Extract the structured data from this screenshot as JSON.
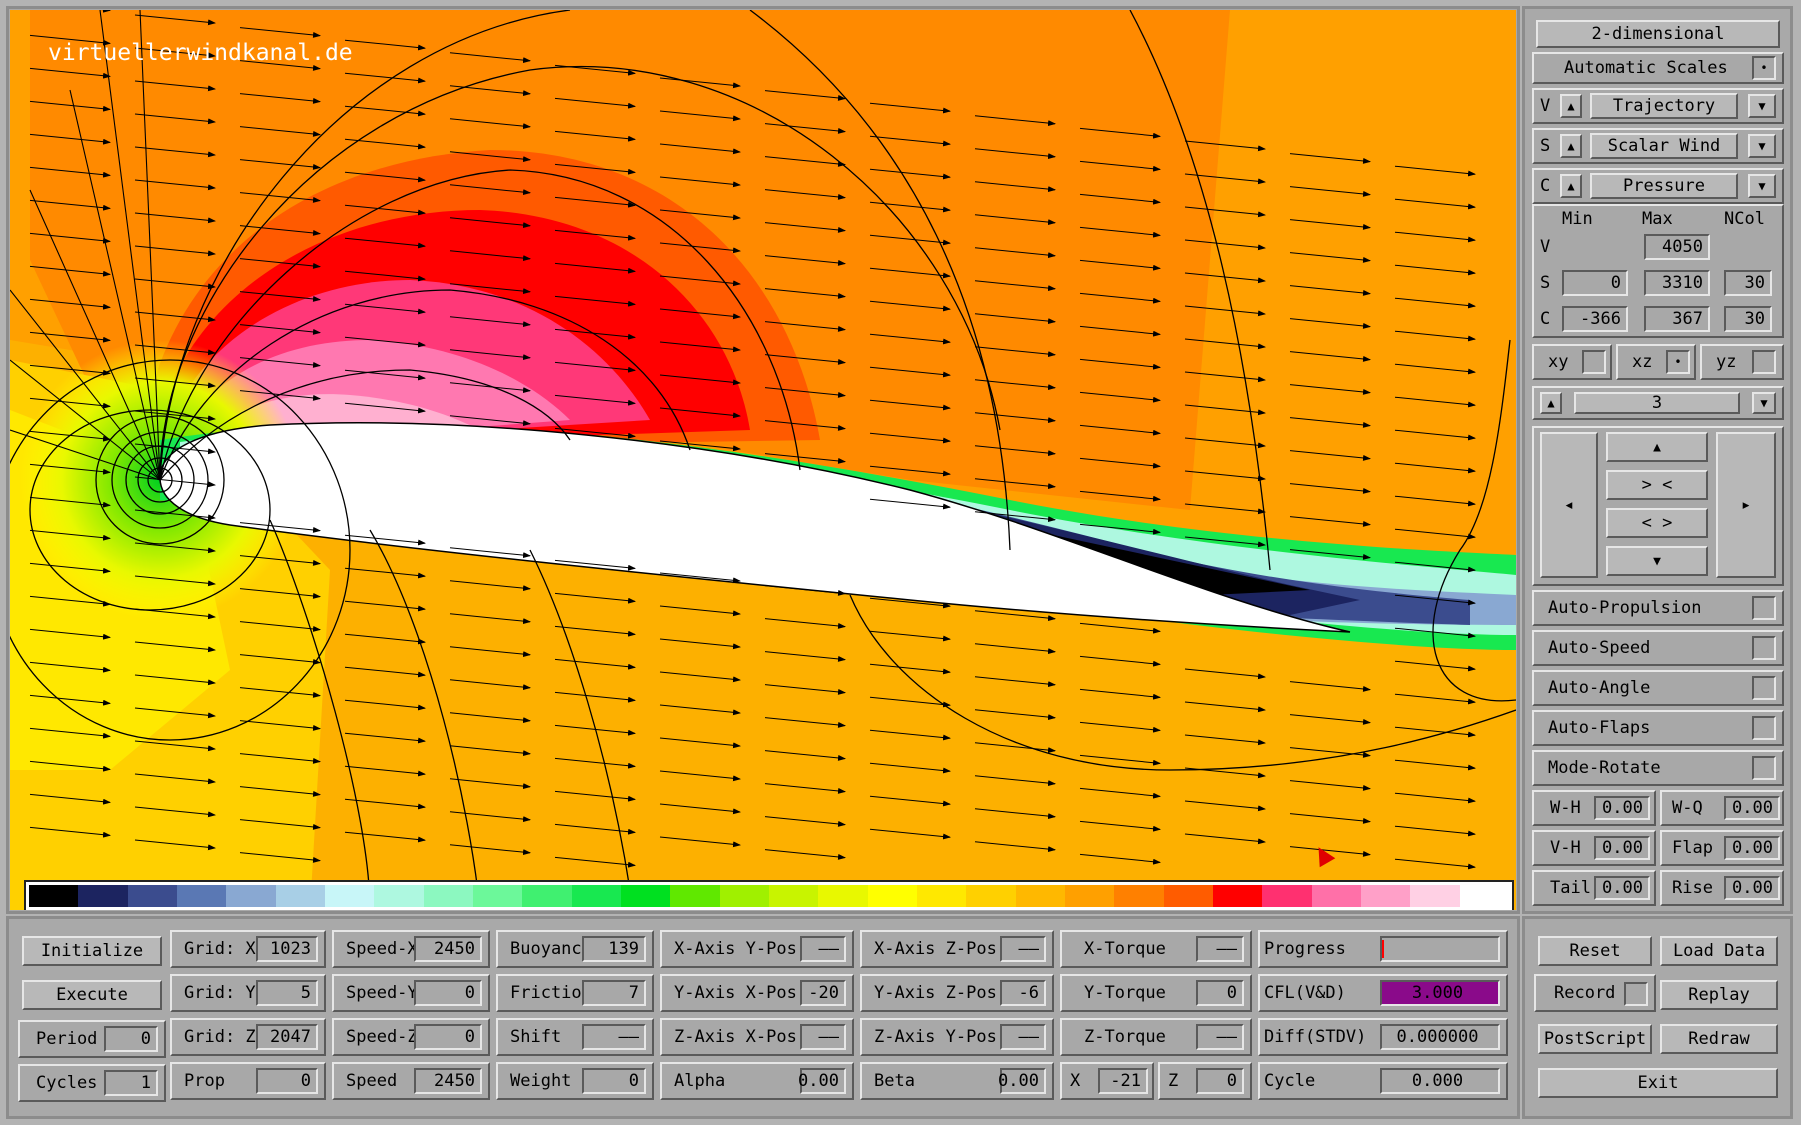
{
  "viz": {
    "watermark": "virtuellerwindkanal.de",
    "colorbar": [
      "#000000",
      "#1c2460",
      "#3b4c8e",
      "#5a78b4",
      "#89a8d2",
      "#a8cfe6",
      "#c8f6f8",
      "#aef8e0",
      "#8cf8c0",
      "#6cf89a",
      "#40f070",
      "#18e850",
      "#00e020",
      "#60e800",
      "#a0f000",
      "#c8f400",
      "#e8f800",
      "#ffff00",
      "#ffe800",
      "#ffd000",
      "#ffb800",
      "#ffa000",
      "#ff8000",
      "#ff5c00",
      "#ff0000",
      "#ff3070",
      "#ff70a8",
      "#ffa0c8",
      "#ffd0e4",
      "#ffffff"
    ]
  },
  "side": {
    "mode": "2-dimensional",
    "scales": "Automatic Scales",
    "rows": [
      {
        "key": "V",
        "value": "Trajectory"
      },
      {
        "key": "S",
        "value": "Scalar Wind"
      },
      {
        "key": "C",
        "value": "Pressure"
      }
    ],
    "range": {
      "h_min": "Min",
      "h_max": "Max",
      "h_ncol": "NCol",
      "v_label": "V",
      "v_max": "4050",
      "s_label": "S",
      "s_min": "0",
      "s_max": "3310",
      "s_ncol": "30",
      "c_label": "C",
      "c_min": "-366",
      "c_max": "367",
      "c_ncol": "30"
    },
    "planes": {
      "xy": "xy",
      "xz": "xz",
      "yz": "yz"
    },
    "slice": "3",
    "nav": {
      "up": "▲",
      "in": "> <",
      "out": "< >",
      "down": "▼",
      "left": "◂",
      "right": "▸"
    },
    "toggles": [
      "Auto-Propulsion",
      "Auto-Speed",
      "Auto-Angle",
      "Auto-Flaps",
      "Mode-Rotate"
    ],
    "pairs": [
      {
        "l1": "W-H",
        "v1": "0.00",
        "l2": "W-Q",
        "v2": "0.00"
      },
      {
        "l1": "V-H",
        "v1": "0.00",
        "l2": "Flap",
        "v2": "0.00"
      },
      {
        "l1": "Tail",
        "v1": "0.00",
        "l2": "Rise",
        "v2": "0.00"
      }
    ]
  },
  "bottom": {
    "c1": {
      "initialize": "Initialize",
      "execute": "Execute",
      "period_label": "Period",
      "period": "0",
      "cycles_label": "Cycles",
      "cycles": "1"
    },
    "c2": {
      "gx": "Grid: X",
      "gx_v": "1023",
      "gy": "Grid: Y",
      "gy_v": "5",
      "gz": "Grid: Z",
      "gz_v": "2047",
      "prop": "Prop",
      "prop_v": "0"
    },
    "c3": {
      "sx": "Speed-X",
      "sx_v": "2450",
      "sy": "Speed-Y",
      "sy_v": "0",
      "sz": "Speed-Z",
      "sz_v": "0",
      "sp": "Speed",
      "sp_v": "2450"
    },
    "c4": {
      "b": "Buoyancy",
      "b_v": "139",
      "f": "Friction",
      "f_v": "7",
      "s": "Shift",
      "s_v": "——",
      "w": "Weight",
      "w_v": "0"
    },
    "c5": {
      "a": "X-Axis Y-Pos",
      "a_v": "——",
      "b": "Y-Axis X-Pos",
      "b_v": "-20",
      "c": "Z-Axis X-Pos",
      "c_v": "——",
      "d": "Alpha",
      "d_v": "0.00"
    },
    "c6": {
      "a": "X-Axis Z-Pos",
      "a_v": "——",
      "b": "Y-Axis Z-Pos",
      "b_v": "-6",
      "c": "Z-Axis Y-Pos",
      "c_v": "——",
      "d": "Beta",
      "d_v": "0.00"
    },
    "c7": {
      "a": "X-Torque",
      "a_v": "——",
      "b": "Y-Torque",
      "b_v": "0",
      "c": "Z-Torque",
      "c_v": "——",
      "x": "X",
      "x_v": "-21",
      "z": "Z",
      "z_v": "0"
    },
    "c8": {
      "a": "Progress",
      "b": "CFL(V&D)",
      "b_v": "3.000",
      "c": "Diff(STDV)",
      "c_v": "0.000000",
      "d": "Cycle",
      "d_v": "0.000"
    },
    "c9": {
      "reset": "Reset",
      "load": "Load Data",
      "record": "Record",
      "replay": "Replay",
      "ps": "PostScript",
      "redraw": "Redraw",
      "exit": "Exit"
    }
  },
  "colors": {
    "cfl_bg": "#8a0a8a",
    "accent": "#ff0000"
  }
}
